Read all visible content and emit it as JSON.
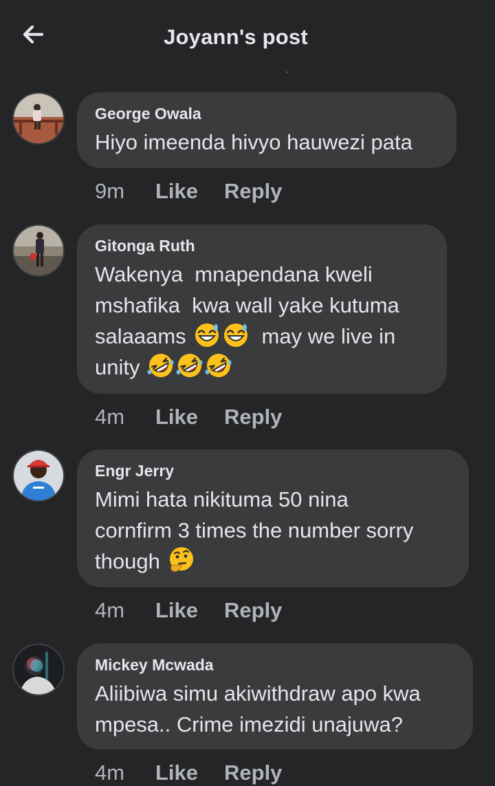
{
  "header": {
    "title": "Joyann's post",
    "back_icon": "arrow-left-icon"
  },
  "comments": [
    {
      "author": "George Owala",
      "text": "Hiyo imeenda hivyo hauwezi pata",
      "time": "9m",
      "like_label": "Like",
      "reply_label": "Reply"
    },
    {
      "author": "Gitonga Ruth",
      "text_line1": "Wakenya  mnapendana kweli",
      "text_line2": "mshafika  kwa wall yake kutuma",
      "text_line3a": "salaaams",
      "text_line3b": "  may we live in",
      "text_line4": "unity",
      "emoji_a": "grinning-sweat-emoji",
      "emoji_b": "rolling-laughing-emoji",
      "time": "4m",
      "like_label": "Like",
      "reply_label": "Reply"
    },
    {
      "author": "Engr Jerry",
      "text_line1": "Mimi hata nikituma 50 nina",
      "text_line2": "cornfirm 3 times the number sorry",
      "text_line3": "though",
      "emoji": "thinking-face-emoji",
      "time": "4m",
      "like_label": "Like",
      "reply_label": "Reply"
    },
    {
      "author": "Mickey Mcwada",
      "text_line1": "Aliibiwa simu akiwithdraw apo kwa",
      "text_line2": "mpesa.. Crime imezidi unajuwa?",
      "time": "4m",
      "like_label": "Like",
      "reply_label": "Reply"
    }
  ],
  "colors": {
    "background": "#242526",
    "bubble": "#3a3b3c",
    "text": "#e4e6eb",
    "meta": "#b0b3b8"
  }
}
